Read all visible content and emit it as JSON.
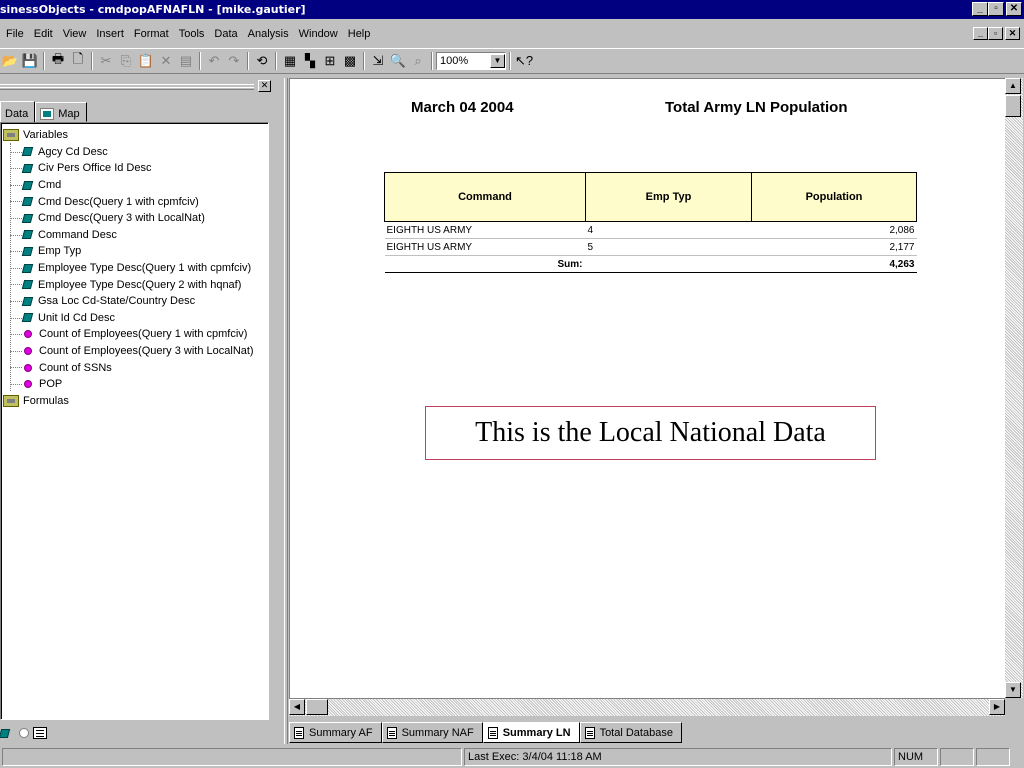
{
  "window": {
    "title": "sinessObjects - cmdpopAFNAFLN - [mike.gautier]",
    "min": "_",
    "max": "▫",
    "close": "✕"
  },
  "menu": [
    "File",
    "Edit",
    "View",
    "Insert",
    "Format",
    "Tools",
    "Data",
    "Analysis",
    "Window",
    "Help"
  ],
  "mdi": {
    "min": "_",
    "restore": "▫",
    "close": "✕"
  },
  "toolbar": {
    "zoom": "100%",
    "icons": [
      "open-icon",
      "save-icon",
      "print-icon",
      "print-preview-icon",
      "cut-icon",
      "copy-icon",
      "paste-icon",
      "delete-icon",
      "clipboard-icon",
      "undo-icon",
      "redo-icon",
      "refresh-icon",
      "report-manager-icon",
      "slice-dice-icon",
      "structure-icon",
      "grid-icon",
      "drill-icon",
      "find-icon",
      "zoom-icon",
      "help-icon"
    ]
  },
  "left_panel": {
    "close": "✕",
    "tabs": [
      {
        "label": "Data",
        "active": true
      },
      {
        "label": "Map",
        "active": false
      }
    ],
    "tree": {
      "variables_label": "Variables",
      "items": [
        {
          "label": "Agcy Cd Desc",
          "kind": "dimension"
        },
        {
          "label": "Civ Pers Office Id Desc",
          "kind": "dimension"
        },
        {
          "label": "Cmd",
          "kind": "dimension"
        },
        {
          "label": "Cmd Desc(Query 1 with cpmfciv)",
          "kind": "dimension"
        },
        {
          "label": "Cmd Desc(Query 3 with LocalNat)",
          "kind": "dimension"
        },
        {
          "label": "Command Desc",
          "kind": "dimension"
        },
        {
          "label": "Emp Typ",
          "kind": "dimension"
        },
        {
          "label": "Employee Type Desc(Query 1 with cpmfciv)",
          "kind": "dimension"
        },
        {
          "label": "Employee Type Desc(Query 2 with hqnaf)",
          "kind": "dimension"
        },
        {
          "label": "Gsa Loc Cd-State/Country Desc",
          "kind": "dimension"
        },
        {
          "label": "Unit Id Cd Desc",
          "kind": "dimension"
        },
        {
          "label": "Count of Employees(Query 1 with cpmfciv)",
          "kind": "measure"
        },
        {
          "label": "Count of Employees(Query 3 with LocalNat)",
          "kind": "measure"
        },
        {
          "label": "Count of SSNs",
          "kind": "measure"
        },
        {
          "label": "POP",
          "kind": "measure"
        }
      ],
      "formulas_label": "Formulas"
    }
  },
  "report": {
    "date": "March 04  2004",
    "title": "Total Army LN Population",
    "columns": [
      "Command",
      "Emp Typ",
      "Population"
    ],
    "rows": [
      {
        "command": "EIGHTH US ARMY",
        "emp_typ": "4",
        "population": "2,086"
      },
      {
        "command": "EIGHTH US ARMY",
        "emp_typ": "5",
        "population": "2,177"
      }
    ],
    "sum_label": "Sum:",
    "sum_value": "4,263",
    "callout": "This is the Local National Data"
  },
  "sheet_tabs": [
    {
      "label": "Summary AF",
      "active": false
    },
    {
      "label": "Summary NAF",
      "active": false
    },
    {
      "label": "Summary LN",
      "active": true
    },
    {
      "label": "Total Database",
      "active": false
    }
  ],
  "status": {
    "last_exec": "Last Exec: 3/4/04  11:18 AM",
    "num": "NUM"
  }
}
